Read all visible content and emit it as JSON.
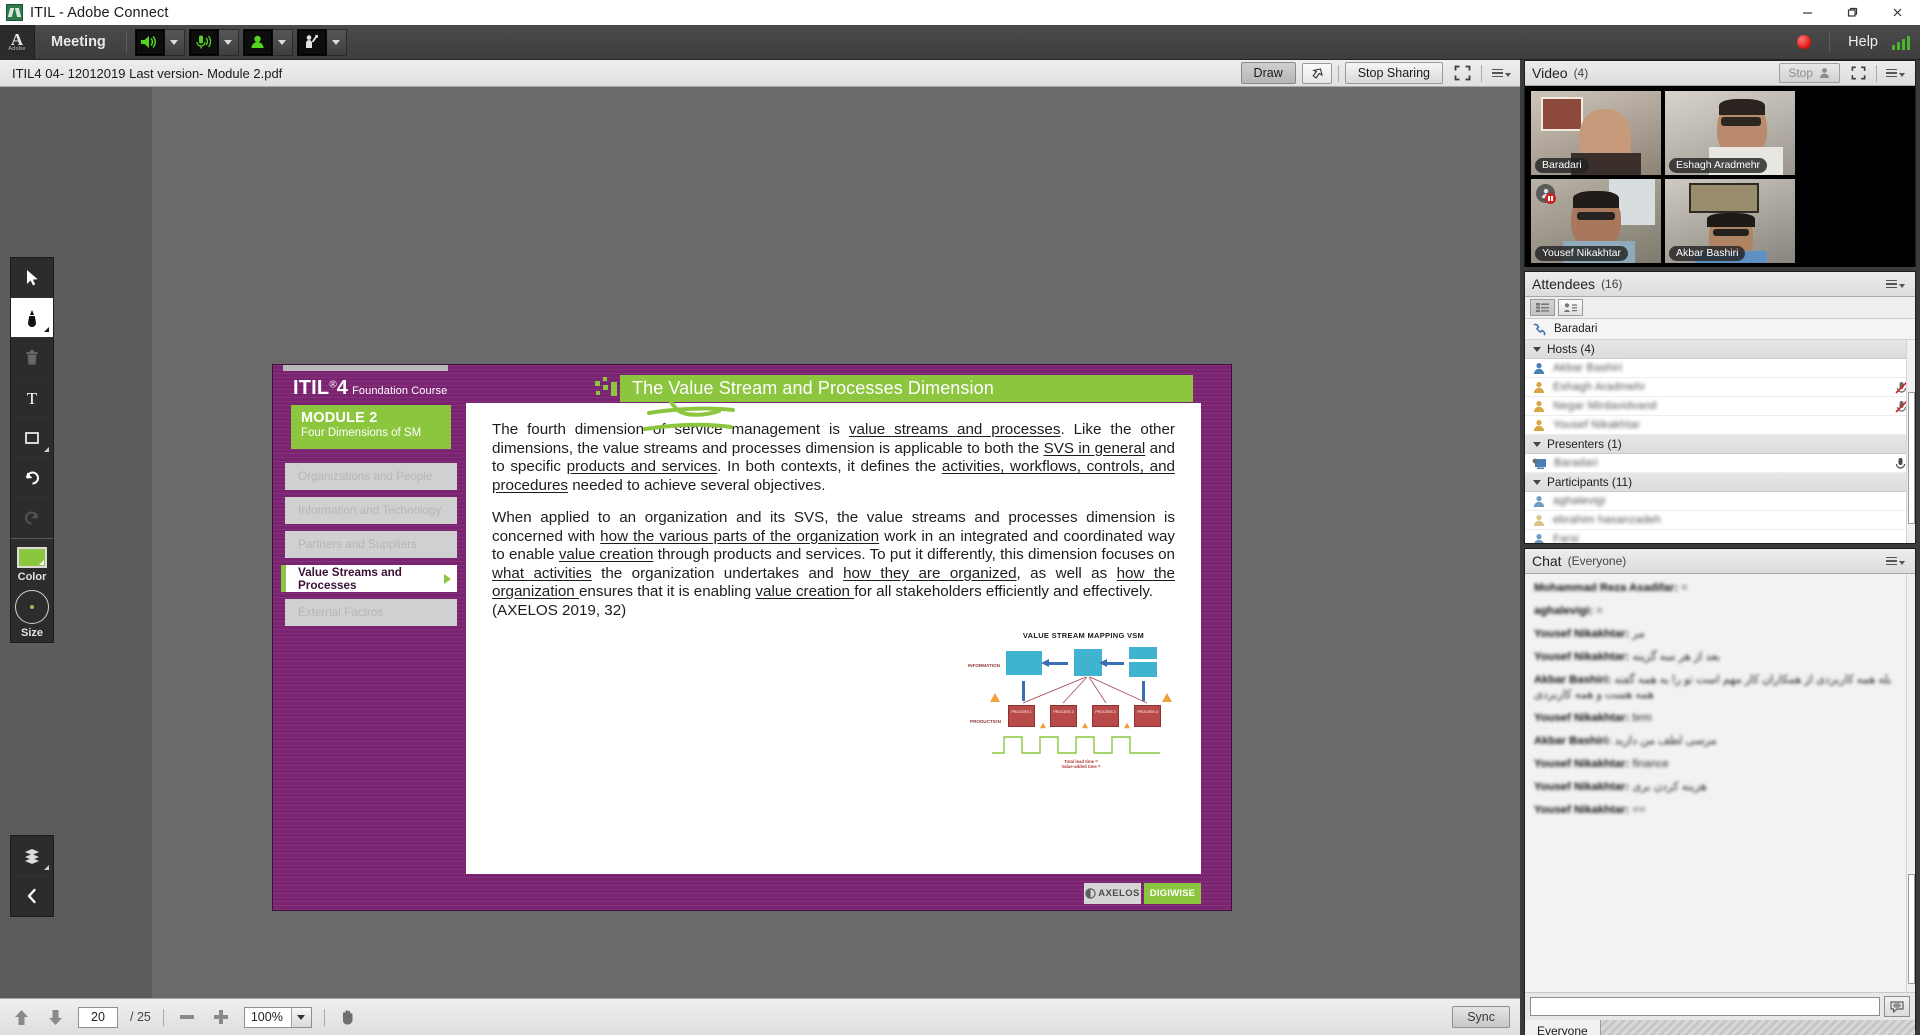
{
  "window": {
    "title": "ITIL - Adobe Connect",
    "app_icon": "adobe-connect-icon",
    "minimize": "—",
    "maximize": "❐",
    "close": "✕"
  },
  "menubar": {
    "brand": "Adobe",
    "brand_letter": "A",
    "meeting_label": "Meeting",
    "speaker_icon": "speaker-icon",
    "microphone_icon": "microphone-icon",
    "camera_icon": "camera-icon",
    "raise-hand_icon": "raise-hand-icon",
    "record_icon": "record-dot-icon",
    "help_label": "Help",
    "connection_icon": "signal-bars-icon",
    "accent_green": "#8cc63f",
    "record_red": "#d80f0f"
  },
  "share_header": {
    "document_name": "ITIL4 04- 12012019 Last version- Module 2.pdf",
    "draw_label": "Draw",
    "pointer_icon": "pointer-arrow-icon",
    "stop_sharing_label": "Stop Sharing",
    "fullscreen_icon": "fullscreen-icon",
    "menu_icon": "pod-menu-icon"
  },
  "draw_toolbar": {
    "tools": [
      {
        "name": "select-tool",
        "icon": "cursor-arrow-icon",
        "selected": false,
        "disabled": false,
        "has_corner": false
      },
      {
        "name": "pen-tool",
        "icon": "marker-pen-icon",
        "selected": true,
        "disabled": false,
        "has_corner": true
      },
      {
        "name": "delete-tool",
        "icon": "trash-icon",
        "selected": false,
        "disabled": true,
        "has_corner": false
      },
      {
        "name": "text-tool",
        "icon": "text-T-icon",
        "selected": false,
        "disabled": false,
        "has_corner": false
      },
      {
        "name": "shape-tool",
        "icon": "rectangle-icon",
        "selected": false,
        "disabled": false,
        "has_corner": true
      },
      {
        "name": "undo-tool",
        "icon": "undo-arrow-icon",
        "selected": false,
        "disabled": false,
        "has_corner": false
      },
      {
        "name": "redo-tool",
        "icon": "redo-arrow-icon",
        "selected": false,
        "disabled": true,
        "has_corner": false
      }
    ],
    "color_label": "Color",
    "color_value": "#8cc63f",
    "size_label": "Size",
    "layers_icon": "layers-icon",
    "collapse_icon": "chevron-left-icon"
  },
  "slide": {
    "brand_name": "ITIL",
    "brand_sup": "®",
    "brand_num": "4",
    "brand_sub": "Foundation Course",
    "module_title": "MODULE 2",
    "module_sub": "Four Dimensions of SM",
    "nav_items": [
      {
        "label": "Organizations and People",
        "active": false
      },
      {
        "label": "Information and Technology",
        "active": false
      },
      {
        "label": "Partners and Suppliers",
        "active": false
      },
      {
        "label": "Value Streams and Processes",
        "active": true
      },
      {
        "label": "External Factros",
        "active": false
      }
    ],
    "slide_title": "The Value Stream and Processes Dimension",
    "paragraph_1_html": "The fourth dimension of service management is <u>value streams and processes</u>. Like the other dimensions, the value streams and processes dimension is applicable to both the <u>SVS in general</u> and to specific <u>products and services</u>. In both contexts, it defines the <u>activities, workflows, controls, and procedures</u> needed to achieve several objectives.",
    "paragraph_2_html": "When applied to an organization and its SVS, the value streams and processes dimension is concerned with <u>how the various parts of the organization</u> work in an integrated and coordinated way to enable <u>value creation</u> through products and services. To put it differently, this dimension focuses on <u>what activities</u> the organization undertakes and <u>how they are organized</u>, as well as <u>how the organization </u>ensures that it is enabling <u>value creation </u>for all stakeholders efficiently and effectively.<br>(AXELOS 2019, 32)",
    "diagram": {
      "title": "VALUE STREAM MAPPING VSM",
      "row_labels": [
        "INFORMATION",
        "PRODUCTION"
      ],
      "process_labels": [
        "PROCESS 1",
        "PROCESS 2",
        "PROCESS 3",
        "PROCESS 4"
      ],
      "footer_line_1": "Total lead time  =",
      "footer_line_2": "Value-added time  ="
    },
    "logo_axelos": "AXELOS",
    "logo_digiwise": "DIGIWISE",
    "purple": "#7a2371",
    "green": "#8cc63f",
    "annotation_color": "#8cc63f"
  },
  "bottom_bar": {
    "prev_icon": "arrow-up-icon",
    "next_icon": "arrow-down-icon",
    "page_current": "20",
    "page_total": "/ 25",
    "zoom_out_icon": "minus-icon",
    "zoom_in_icon": "plus-icon",
    "zoom_value": "100%",
    "pan_icon": "hand-icon",
    "sync_label": "Sync"
  },
  "video_pod": {
    "title": "Video",
    "count": "(4)",
    "stop_label": "Stop",
    "stop_icon": "camera-person-icon",
    "fullscreen_icon": "fullscreen-icon",
    "menu_icon": "pod-menu-icon",
    "tiles": [
      {
        "name": "Baradari",
        "paused": false
      },
      {
        "name": "Eshagh Aradmehr",
        "paused": false
      },
      {
        "name": "Yousef Nikakhtar",
        "paused": true
      },
      {
        "name": "Akbar Bashiri",
        "paused": false
      }
    ]
  },
  "attendees_pod": {
    "title": "Attendees",
    "count": "(16)",
    "menu_icon": "pod-menu-icon",
    "view_list_icon": "list-view-icon",
    "view_status_icon": "status-view-icon",
    "self_name": "Baradari",
    "self_icon": "phone-icon",
    "groups": [
      {
        "label": "Hosts (4)",
        "rows": [
          {
            "name": "Akbar Bashiri",
            "icon": "host-icon",
            "blue": true,
            "mic_muted": false
          },
          {
            "name": "Eshagh Aradmehr",
            "icon": "host-icon",
            "blue": false,
            "mic_muted": true
          },
          {
            "name": "Negar Mirdavidvand",
            "icon": "host-icon",
            "blue": false,
            "mic_muted": true
          },
          {
            "name": "Yousef Nikakhtar",
            "icon": "host-icon",
            "blue": false,
            "mic_muted": false
          }
        ]
      },
      {
        "label": "Presenters (1)",
        "rows": [
          {
            "name": "Baradari",
            "icon": "presenter-screen-icon",
            "blue": true,
            "mic_active": true
          }
        ]
      },
      {
        "label": "Participants (11)",
        "rows": [
          {
            "name": "aghalevigi",
            "icon": "participant-icon",
            "blue": true,
            "mic_muted": false
          },
          {
            "name": "ebrahim hasanzadeh",
            "icon": "participant-icon",
            "blue": false,
            "mic_muted": false
          },
          {
            "name": "Farsi",
            "icon": "participant-icon",
            "blue": true,
            "mic_muted": false
          }
        ]
      }
    ]
  },
  "chat_pod": {
    "title": "Chat",
    "scope": "(Everyone)",
    "menu_icon": "pod-menu-icon",
    "messages": [
      {
        "sender": "Mohammad Reza Asadifar:",
        "text": "="
      },
      {
        "sender": "aghalevigi:",
        "text": "="
      },
      {
        "sender": "Yousef Nikakhtar:",
        "text": "مر"
      },
      {
        "sender": "Yousef Nikakhtar:",
        "text": "بعد از هر سه گزینه"
      },
      {
        "sender": "Akbar Bashiri:",
        "text": "بله همه کاربردی از همکاران کار مهم است تو را به همه گفته همه هست و همه کاربردی"
      },
      {
        "sender": "Yousef Nikakhtar:",
        "text": "brm"
      },
      {
        "sender": "Akbar Bashiri:",
        "text": "مرسی لطف من دارید"
      },
      {
        "sender": "Yousef Nikakhtar:",
        "text": "finance"
      },
      {
        "sender": "Yousef Nikakhtar:",
        "text": "هزینه کردن بری"
      },
      {
        "sender": "Yousef Nikakhtar:",
        "text": "=="
      }
    ],
    "input_placeholder": "",
    "input_value": "",
    "send_icon": "chat-bubble-icon",
    "tab_label": "Everyone"
  }
}
